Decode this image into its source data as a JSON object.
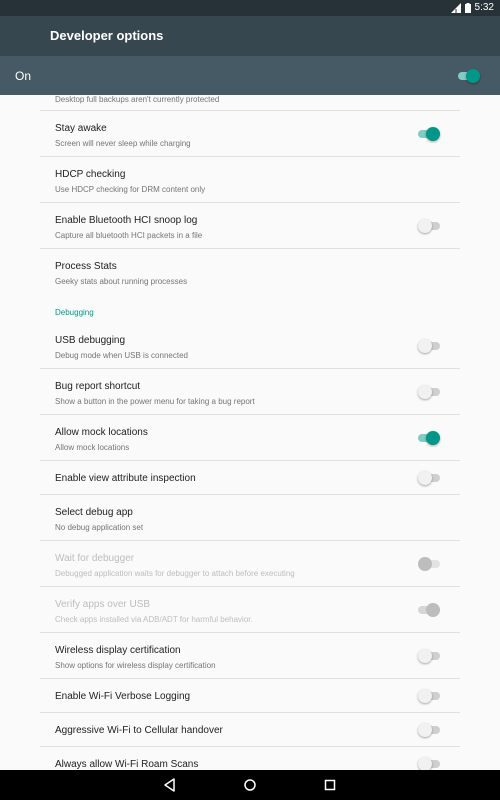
{
  "status_bar": {
    "time": "5:32"
  },
  "app_bar": {
    "title": "Developer options"
  },
  "master": {
    "label": "On",
    "enabled": true
  },
  "partial": {
    "subtitle": "Desktop full backups aren't currently protected"
  },
  "items_top": [
    {
      "title": "Stay awake",
      "subtitle": "Screen will never sleep while charging",
      "switch": "on"
    },
    {
      "title": "HDCP checking",
      "subtitle": "Use HDCP checking for DRM content only",
      "switch": "none"
    },
    {
      "title": "Enable Bluetooth HCI snoop log",
      "subtitle": "Capture all bluetooth HCI packets in a file",
      "switch": "off"
    },
    {
      "title": "Process Stats",
      "subtitle": "Geeky stats about running processes",
      "switch": "none"
    }
  ],
  "category": {
    "label": "Debugging"
  },
  "items_debug": [
    {
      "title": "USB debugging",
      "subtitle": "Debug mode when USB is connected",
      "switch": "off"
    },
    {
      "title": "Bug report shortcut",
      "subtitle": "Show a button in the power menu for taking a bug report",
      "switch": "off"
    },
    {
      "title": "Allow mock locations",
      "subtitle": "Allow mock locations",
      "switch": "on"
    },
    {
      "title": "Enable view attribute inspection",
      "subtitle": "",
      "switch": "off"
    },
    {
      "title": "Select debug app",
      "subtitle": "No debug application set",
      "switch": "none"
    },
    {
      "title": "Wait for debugger",
      "subtitle": "Debugged application waits for debugger to attach before executing",
      "switch": "off-disabled"
    },
    {
      "title": "Verify apps over USB",
      "subtitle": "Check apps installed via ADB/ADT for harmful behavior.",
      "switch": "on-disabled"
    },
    {
      "title": "Wireless display certification",
      "subtitle": "Show options for wireless display certification",
      "switch": "off"
    },
    {
      "title": "Enable Wi-Fi Verbose Logging",
      "subtitle": "",
      "switch": "off"
    },
    {
      "title": "Aggressive Wi-Fi to Cellular handover",
      "subtitle": "",
      "switch": "off"
    },
    {
      "title": "Always allow Wi-Fi Roam Scans",
      "subtitle": "",
      "switch": "off"
    }
  ],
  "nav": {
    "back": "back-icon",
    "home": "home-icon",
    "recents": "recents-icon"
  }
}
